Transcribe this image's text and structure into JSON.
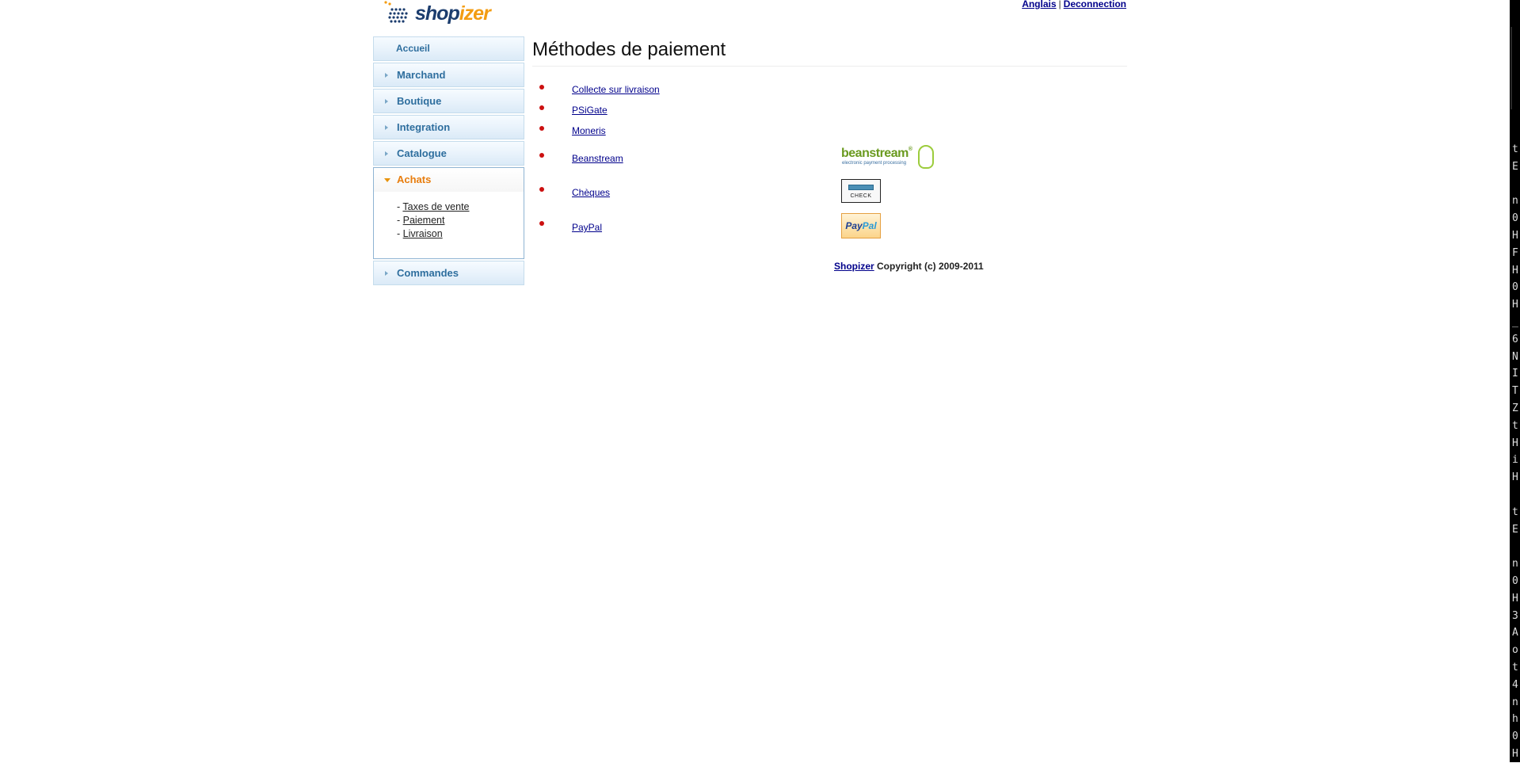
{
  "header": {
    "logo_prefix": "shop",
    "logo_suffix": "izer",
    "language_link": "Anglais",
    "separator": "|",
    "logout_link": "Deconnection"
  },
  "sidebar": {
    "home": "Accueil",
    "items": [
      {
        "label": "Marchand"
      },
      {
        "label": "Boutique"
      },
      {
        "label": "Integration"
      },
      {
        "label": "Catalogue"
      }
    ],
    "active": {
      "label": "Achats",
      "subitems": [
        {
          "prefix": "- ",
          "label": "Taxes de vente"
        },
        {
          "prefix": "- ",
          "label": "Paiement"
        },
        {
          "prefix": "- ",
          "label": "Livraison"
        }
      ]
    },
    "after": {
      "label": "Commandes"
    }
  },
  "main": {
    "title": "Méthodes de paiement",
    "methods": [
      {
        "label": "Collecte sur livraison",
        "logo": ""
      },
      {
        "label": "PSiGate",
        "logo": ""
      },
      {
        "label": "Moneris",
        "logo": ""
      },
      {
        "label": "Beanstream",
        "logo": "beanstream-logo"
      },
      {
        "label": "Chèques",
        "logo": "check-logo"
      },
      {
        "label": "PayPal",
        "logo": "paypal-logo"
      }
    ],
    "beanstream_logo": {
      "word": "beanstream",
      "tm": "®",
      "sub": "electronic payment processing"
    },
    "check_logo_text": "CHECK",
    "paypal_logo": {
      "pay": "Pay",
      "pal": "Pal"
    },
    "footer": {
      "link": "Shopizer",
      "text": " Copyright (c) 2009-2011"
    }
  },
  "terminal_strip": {
    "chars": [
      "t",
      "E",
      "",
      "n",
      "0",
      "H",
      "F",
      "H",
      "0",
      "H",
      "_",
      "6",
      "N",
      "I",
      "T",
      "Z",
      "t",
      "H",
      "i",
      "H",
      "",
      "t",
      "E",
      "",
      "n",
      "0",
      "H",
      "3",
      "A",
      "o",
      "t",
      "4",
      "n",
      "h",
      "0",
      "H"
    ]
  },
  "colors": {
    "nav_text": "#2e6e9e",
    "nav_active": "#e87d0d",
    "bullet": "#cc1010",
    "link": "#00008b"
  }
}
